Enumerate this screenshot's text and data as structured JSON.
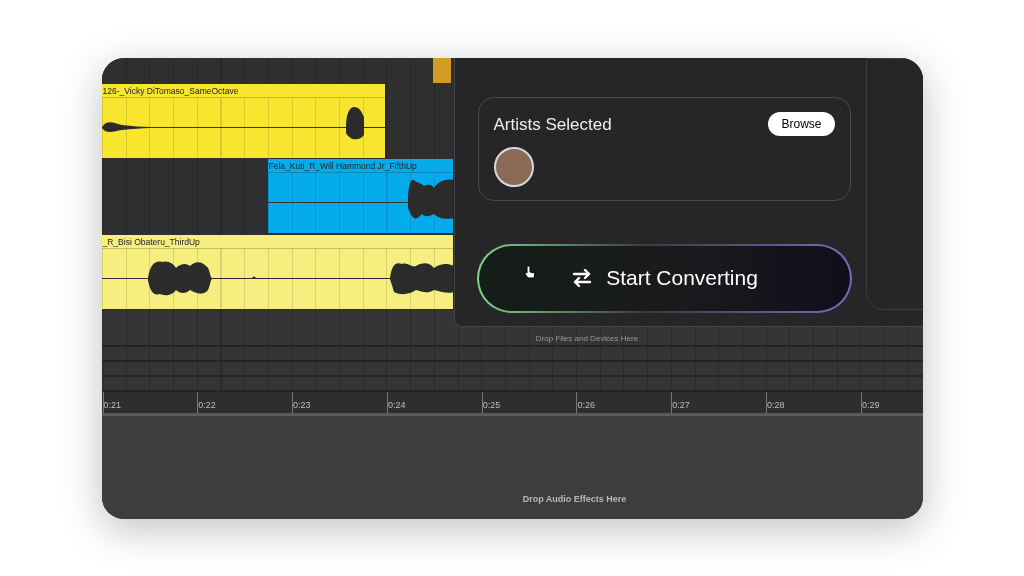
{
  "clips": [
    {
      "label": "126-_Vicky DiTomaso_SameOctave",
      "color": "#f8e52f"
    },
    {
      "label": "Fela_Kuti_R_Will Hammond Jr_FifthUp",
      "color": "#04acec"
    },
    {
      "label": "_R_Bisi Obateru_ThirdUp",
      "color": "#f6ee7f"
    }
  ],
  "track_drop_hint": "Drop Files and Devices Here",
  "ruler": [
    "0:21",
    "0:22",
    "0:23",
    "0:24",
    "0:25",
    "0:26",
    "0:27",
    "0:28",
    "0:29"
  ],
  "effects_drop_hint": "Drop Audio Effects Here",
  "panel": {
    "artists_title": "Artists Selected",
    "browse_button": "Browse",
    "convert_button": "Start Converting"
  }
}
